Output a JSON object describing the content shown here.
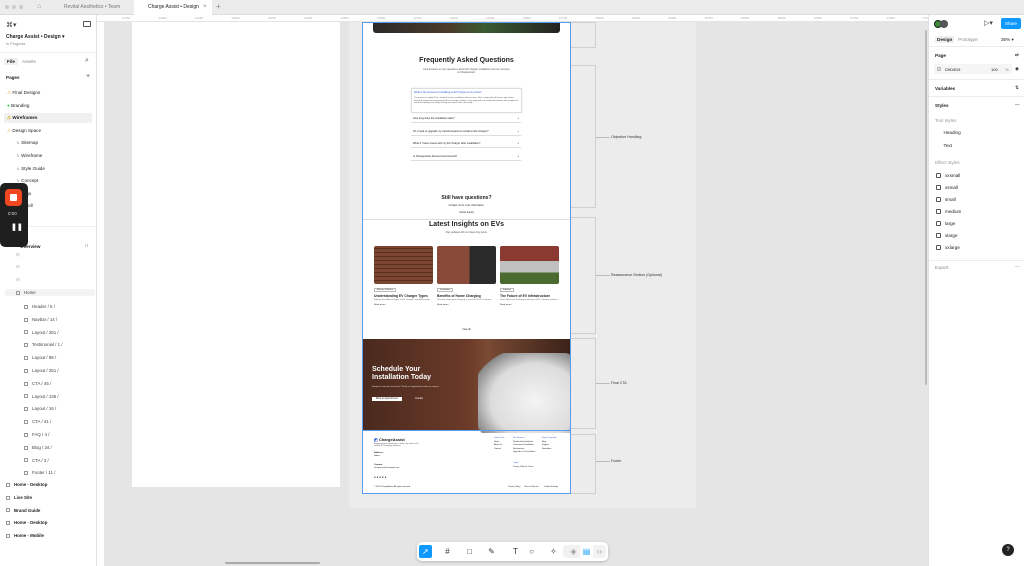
{
  "tabs": [
    {
      "label": "Revital Aesthetics • Team"
    },
    {
      "label": "Charge Assist • Design"
    }
  ],
  "sidebar": {
    "file_title": "Charge Assist • Design",
    "status": "In Progress",
    "tab_file": "File",
    "tab_assets": "Assets",
    "pages_label": "Pages",
    "pages": [
      {
        "label": "Final Designs",
        "icon": "⚠"
      },
      {
        "label": "Branding",
        "icon": "●"
      },
      {
        "label": "Wireframes",
        "icon": "⚠"
      },
      {
        "label": "Design Space",
        "icon": "⚠"
      },
      {
        "label": "Sitemap"
      },
      {
        "label": "Wireframe"
      },
      {
        "label": "Style Guide"
      },
      {
        "label": "Concept"
      },
      {
        "label": "Logo"
      },
      {
        "label": "Scroll"
      }
    ],
    "layers_header": "Overview",
    "home": "Home",
    "children": [
      "Header / 5 /",
      "Navbar / 14 /",
      "Layout / 251 /",
      "Testimonial / 1 /",
      "Layout / 99 /",
      "Layout / 251 /",
      "CTA / 45 /",
      "Layout / 136 /",
      "Layout / 16 /",
      "CTA / 41 /",
      "FAQ / 4 /",
      "Blog / 34 /",
      "CTA / 3 /",
      "Footer / 11 /"
    ],
    "frames": [
      "Home - Desktop",
      "Live Site",
      "Brand Guide",
      "Home - Desktop",
      "Home - Mobile"
    ]
  },
  "recorder": {
    "time": "0:00"
  },
  "rulers": {
    "top": [
      "11750",
      "12000",
      "12250",
      "12500",
      "12750",
      "13000",
      "13250",
      "13500",
      "13750",
      "14000",
      "14250",
      "14500",
      "14750",
      "15000",
      "15250",
      "15500",
      "15750",
      "16000",
      "16250",
      "16500",
      "16750",
      "17000",
      "17250"
    ]
  },
  "right_panel": {
    "tab_design": "Design",
    "tab_prototype": "Prototype",
    "zoom": "36%",
    "share": "Share",
    "page_label": "Page",
    "page_color": "D9D9D9",
    "page_opacity": "100",
    "percent": "%",
    "variables": "Variables",
    "styles": "Styles",
    "text_styles_label": "Text styles",
    "text_styles": [
      "Heading",
      "Text"
    ],
    "effect_styles_label": "Effect styles",
    "effect_styles": [
      "xxsmall",
      "xsmall",
      "small",
      "medium",
      "large",
      "xlarge",
      "xxlarge"
    ],
    "export": "Export"
  },
  "design": {
    "faq_title": "Frequently Asked Questions",
    "faq_sub": "Find answers to your questions about EV charger installation and our services at ChargeAssist.",
    "faq_open_q": "What is the process for installing an EV charger at my home?",
    "faq_open_a": "The process is simple! First, schedule a free consultation with our team. Next, a specialist will assess your home's electrical system and recommend the best charger solution. Once approved, our certified electricians will complete the installation quickly and safely, leaving your space clean and ready.",
    "faq_items": [
      "How long does the installation take?",
      "Do I need to upgrade my electrical panel to install an EV charger?",
      "What if I have issues with my EV charger after installation?",
      "Is ChargeAssist licensed and insured?"
    ],
    "still_title": "Still have questions?",
    "still_sub": "Contact us for more information.",
    "still_btn": "Submit Inquiry",
    "blog_title": "Latest Insights on EVs",
    "blog_sub": "Stay updated with our latest blog posts.",
    "posts": [
      {
        "tag": "Electric Vehicles",
        "title": "Understanding EV Charger Types",
        "desc": "Explore the different types of EV chargers available today.",
        "read": "Read more"
      },
      {
        "tag": "Installation",
        "title": "Benefits of Home Charging",
        "desc": "Discover why home charging is essential for EV owners.",
        "read": "Read more"
      },
      {
        "tag": "Industry",
        "title": "The Future of EV Infrastructure",
        "desc": "Learn about the evolving landscape of EV charging stations.",
        "read": "Read more"
      }
    ],
    "view_all": "View all",
    "cta_title": "Schedule Your Installation Today",
    "cta_sub": "Ready to transition to electric? Book an appointment with our experts.",
    "cta_btn": "Book an Appointment",
    "cta_btn2": "Contact",
    "footer_brand": "ChargeAssist",
    "footer_tagline": "Empowering homeowners to make the switch with reliable EV charging solutions.",
    "footer_address_label": "Address:",
    "footer_address": "Hobart",
    "footer_contact_label": "Contact:",
    "footer_email": "chargeassist@example.com",
    "footer_cols": [
      {
        "head": "Quick Links",
        "items": [
          "Home",
          "About Us",
          "Contact"
        ]
      },
      {
        "head": "Our Services",
        "items": [
          "Residential Installation",
          "Commercial Installation",
          "Maintenance",
          "Upgrades & Consultation"
        ]
      },
      {
        "head": "Stay Connected",
        "items": [
          "Blog",
          "Support",
          "Newsletter"
        ]
      }
    ],
    "footer_legal": {
      "head": "Legal",
      "item": "Privacy Policy & Terms"
    },
    "copyright": "© 2024 ChargeAssist. All rights reserved.",
    "footer_links": [
      "Privacy Policy",
      "Terms of Service",
      "Cookie Settings"
    ]
  },
  "annotations": [
    "Objection Handling",
    "Reassurance Section (Optional)",
    "Final CTA",
    "Footer"
  ],
  "colors": {
    "accent": "#0d99ff",
    "selection": "#5a9cf0",
    "record": "#f24822"
  }
}
